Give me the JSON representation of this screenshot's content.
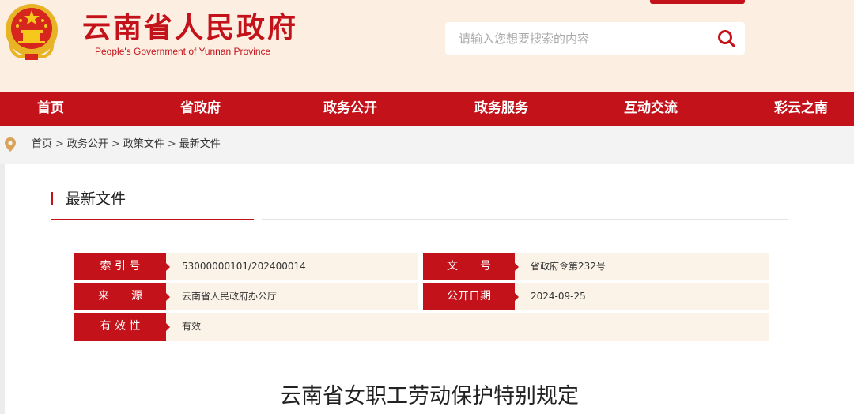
{
  "header": {
    "title": "云南省人民政府",
    "subtitle": "People's Government of Yunnan Province",
    "emblem_icon": "national-emblem-icon",
    "search": {
      "placeholder": "请输入您想要搜索的内容",
      "value": "",
      "icon": "search-icon"
    }
  },
  "nav": {
    "items": [
      {
        "label": "首页"
      },
      {
        "label": "省政府"
      },
      {
        "label": "政务公开"
      },
      {
        "label": "政务服务"
      },
      {
        "label": "互动交流"
      },
      {
        "label": "彩云之南"
      }
    ]
  },
  "breadcrumb": {
    "icon": "location-pin-icon",
    "items": [
      "首页",
      "政务公开",
      "政策文件",
      "最新文件"
    ],
    "separator": ">"
  },
  "section": {
    "title": "最新文件"
  },
  "meta": {
    "index_label": "索 引 号",
    "index_value": "53000000101/202400014",
    "doc_no_label": "文　　号",
    "doc_no_value": "省政府令第232号",
    "source_label": "来　　源",
    "source_value": "云南省人民政府办公厅",
    "date_label": "公开日期",
    "date_value": "2024-09-25",
    "validity_label": "有 效 性",
    "validity_value": "有效"
  },
  "document": {
    "title": "云南省女职工劳动保护特别规定"
  },
  "colors": {
    "brand_red": "#c4121a",
    "header_bg": "#fcefe2",
    "meta_bg": "#fbf3e8"
  }
}
